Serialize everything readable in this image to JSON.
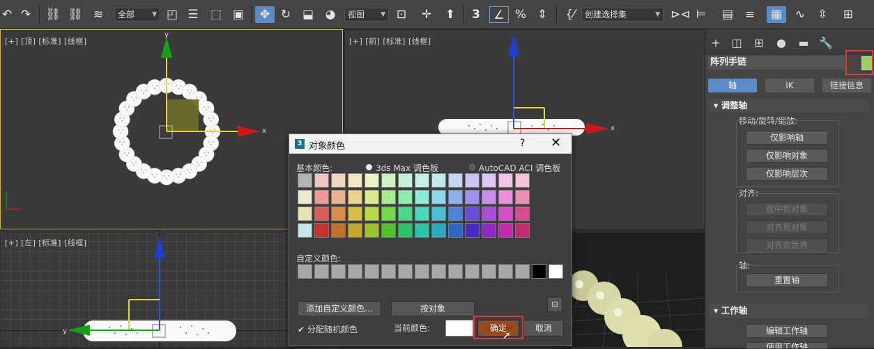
{
  "toolbar": {
    "selection_filter": "全部",
    "reference_coord": "视图",
    "selection_set": "创建选择集",
    "icons": [
      "undo-icon",
      "redo-icon",
      "link-icon",
      "unlink-icon",
      "bind-space-warp-icon",
      "select-object-icon",
      "select-by-name-icon",
      "rect-selection-icon",
      "window-crossing-icon",
      "select-move-icon",
      "select-rotate-icon",
      "select-scale-icon",
      "placement-icon",
      "use-pivot-icon",
      "select-manipulate-icon",
      "keyboard-shortcut-icon",
      "snap-3d-icon",
      "angle-snap-icon",
      "percent-snap-icon",
      "spinner-snap-icon",
      "edit-named-selection-icon",
      "mirror-icon",
      "align-icon",
      "layer-explorer-icon",
      "toggle-ribbon-icon",
      "curve-editor-icon",
      "schematic-view-icon",
      "material-editor-icon",
      "render-setup-icon"
    ]
  },
  "viewports": {
    "top_label": "[+] [顶] [标准] [线框]",
    "front_label": "[+] [前] [标准] [线框]",
    "left_label": "[+] [左] [标准] [线框]",
    "persp_label": "",
    "axis_x": "x",
    "axis_y": "y"
  },
  "command_panel": {
    "tabs": [
      "create-icon",
      "modify-icon",
      "hierarchy-icon",
      "motion-icon",
      "display-icon",
      "utilities-icon"
    ],
    "object_name": "阵列手链",
    "object_color": "#9bd35a",
    "subtabs": [
      "轴",
      "IK",
      "链接信息"
    ],
    "adjust_pivot": {
      "title": "调整轴",
      "move_rotate_scale": "移动/旋转/缩放:",
      "affect_pivot_only": "仅影响轴",
      "affect_object_only": "仅影响对象",
      "affect_hierarchy_only": "仅影响层次",
      "align_label": "对齐:",
      "center_to_object": "居中到对象",
      "align_to_object": "对齐到对象",
      "align_to_world": "对齐到世界",
      "pivot_label": "轴:",
      "reset_pivot": "重置轴"
    },
    "working_pivot": {
      "title": "工作轴",
      "edit_working_pivot": "编辑工作轴",
      "use_working_pivot": "使用工作轴"
    }
  },
  "dialog": {
    "title": "对象颜色",
    "help": "?",
    "close": "✕",
    "basic_colors_label": "基本颜色:",
    "palette_3dsmax": "3ds Max 调色板",
    "palette_autocad": "AutoCAD ACI 调色板",
    "basic_colors": [
      [
        "#b3b3b3",
        "#f2c4c4",
        "#f2d6c4",
        "#f2e6c4",
        "#e8f2c4",
        "#d2f2c4",
        "#c4f2d2",
        "#c4f2e8",
        "#c4e8f2",
        "#c4d6f2",
        "#ccc4f2",
        "#e0c4f2",
        "#f2c4ea",
        "#f2c4d8"
      ],
      [
        "#ecebd2",
        "#eb9a9a",
        "#ebb48f",
        "#ebd38f",
        "#d9eb8f",
        "#a8eb8f",
        "#8febb0",
        "#8febd6",
        "#8fd6eb",
        "#8fb0eb",
        "#a08feb",
        "#c78feb",
        "#eb8fdc",
        "#eb8fb7"
      ],
      [
        "#e8e2b8",
        "#d85e5e",
        "#d88e4c",
        "#d8bf4c",
        "#bcd84c",
        "#74d84c",
        "#4cd884",
        "#4cd8bf",
        "#4cbfd8",
        "#4c84d8",
        "#6a4cd8",
        "#a94cd8",
        "#d84cc7",
        "#d84c90"
      ],
      [
        "#c8e6ea",
        "#c43232",
        "#c4702a",
        "#c4a82a",
        "#9ec42a",
        "#4ec42a",
        "#2ac468",
        "#2ac4a8",
        "#2aa8c4",
        "#2a68c4",
        "#4a2ac4",
        "#8e2ac4",
        "#c42aae",
        "#c42a6e"
      ]
    ],
    "custom_colors_label": "自定义颜色:",
    "custom_colors": [
      "#a8a8a8",
      "#a8a8a8",
      "#a8a8a8",
      "#a8a8a8",
      "#a8a8a8",
      "#a8a8a8",
      "#a8a8a8",
      "#a8a8a8",
      "#a8a8a8",
      "#a8a8a8",
      "#a8a8a8",
      "#a8a8a8",
      "#a8a8a8",
      "#a8a8a8",
      "#000000",
      "#ffffff"
    ],
    "add_custom_color": "添加自定义颜色...",
    "by_object": "按对象",
    "assign_random_colors": "分配随机颜色",
    "current_color_label": "当前颜色:",
    "current_color": "#ffffff",
    "ok": "确定",
    "cancel": "取消"
  }
}
